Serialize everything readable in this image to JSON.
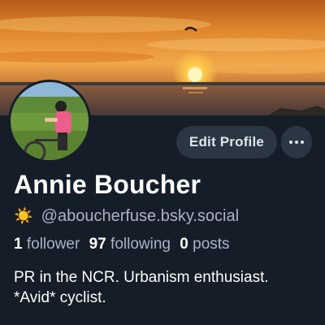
{
  "profile": {
    "display_name": "Annie Boucher",
    "handle": "@aboucherfuse.bsky.social",
    "handle_emoji": "☀️",
    "bio_line1": "PR in the NCR. Urbanism enthusiast.",
    "bio_line2": "*Avid* cyclist."
  },
  "stats": {
    "followers_count": "1",
    "followers_label": "follower",
    "following_count": "97",
    "following_label": "following",
    "posts_count": "0",
    "posts_label": "posts"
  },
  "actions": {
    "edit_label": "Edit Profile",
    "more_icon": "ellipsis-icon"
  },
  "colors": {
    "background": "#151d28",
    "button_bg": "#2a3644",
    "muted_text": "#a9b4c2"
  }
}
